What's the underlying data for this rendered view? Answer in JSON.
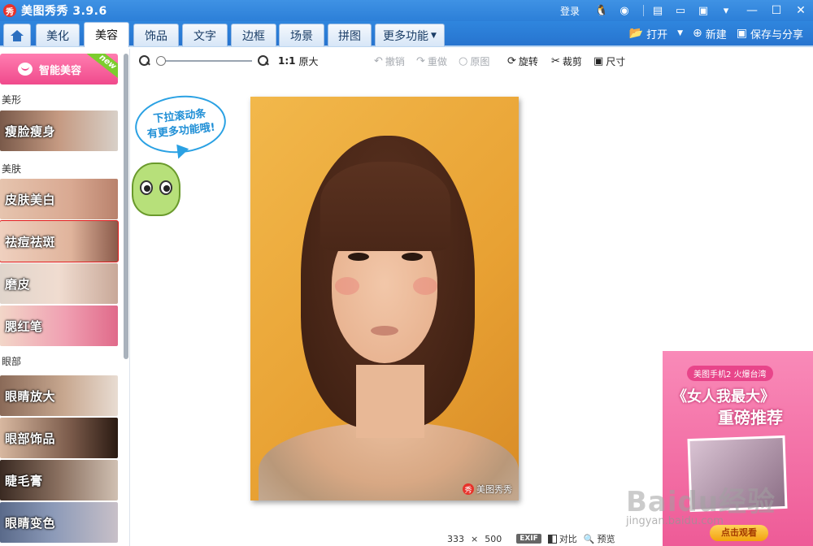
{
  "app": {
    "logo": "秀",
    "title": "美图秀秀 3.9.6",
    "login": "登录"
  },
  "tabs": [
    {
      "label": "美化"
    },
    {
      "label": "美容"
    },
    {
      "label": "饰品"
    },
    {
      "label": "文字"
    },
    {
      "label": "边框"
    },
    {
      "label": "场景"
    },
    {
      "label": "拼图"
    },
    {
      "label": "更多功能"
    }
  ],
  "file_actions": {
    "open": "打开",
    "new": "新建",
    "save_share": "保存与分享"
  },
  "sidebar": {
    "smart_beauty": "智能美容",
    "new_badge": "new",
    "sections": {
      "shape": "美形",
      "skin": "美肤",
      "eyes": "眼部"
    },
    "items": [
      {
        "label": "瘦脸瘦身"
      },
      {
        "label": "皮肤美白"
      },
      {
        "label": "祛痘祛斑"
      },
      {
        "label": "磨皮"
      },
      {
        "label": "腮红笔"
      },
      {
        "label": "眼睛放大"
      },
      {
        "label": "眼部饰品"
      },
      {
        "label": "睫毛膏"
      },
      {
        "label": "眼睛变色"
      }
    ]
  },
  "toolbar": {
    "ratio": "1:1",
    "original_size": "原大",
    "undo": "撤销",
    "redo": "重做",
    "original": "原图",
    "rotate": "旋转",
    "crop": "裁剪",
    "size": "尺寸"
  },
  "mascot": {
    "line1": "下拉滚动条",
    "line2": "有更多功能哦!"
  },
  "photo": {
    "watermark_logo": "秀",
    "watermark": "美图秀秀"
  },
  "status": {
    "width": "333",
    "times": "×",
    "height": "500",
    "exif": "EXIF",
    "compare": "对比",
    "preview": "预览"
  },
  "ad": {
    "top": "美图手机2 火爆台湾",
    "headline": "《女人我最大》",
    "sub": "重磅推荐",
    "button": "点击观看"
  },
  "watermark": {
    "baidu": "Baidu经验",
    "url": "jingyan.baidu.com"
  }
}
